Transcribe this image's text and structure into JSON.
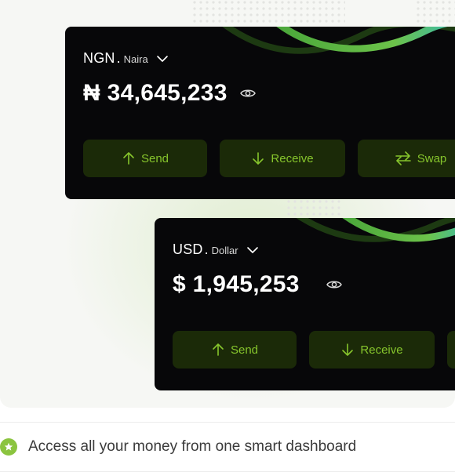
{
  "cards": [
    {
      "currency_code": "NGN",
      "separator": ".",
      "currency_name": "Naira",
      "balance": "₦ 34,645,233",
      "buttons": {
        "send": "Send",
        "receive": "Receive",
        "swap": "Swap"
      }
    },
    {
      "currency_code": "USD",
      "separator": ".",
      "currency_name": "Dollar",
      "balance": "$ 1,945,253",
      "buttons": {
        "send": "Send",
        "receive": "Receive"
      }
    }
  ],
  "feature": {
    "text": "Access all your money from one smart dashboard"
  },
  "colors": {
    "card_bg": "#070709",
    "button_bg": "#1b2a08",
    "button_text": "#86c52c",
    "accent_green": "#8bc43f",
    "swoosh_start": "#6cc24a",
    "swoosh_end": "#2bb8c6"
  },
  "icons": [
    "chevron-down-icon",
    "eye-icon",
    "arrow-up-icon",
    "arrow-down-icon",
    "swap-arrows-icon",
    "star-icon"
  ]
}
